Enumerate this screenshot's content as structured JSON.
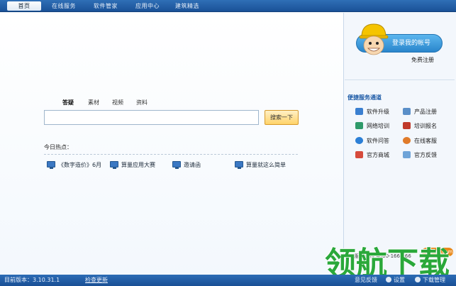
{
  "nav": {
    "tabs": [
      "首页",
      "在线服务",
      "软件管家",
      "应用中心",
      "建筑精选"
    ]
  },
  "search": {
    "tabs": [
      "答疑",
      "素材",
      "视频",
      "资料"
    ],
    "placeholder": "",
    "button": "搜索一下"
  },
  "hot": {
    "title": "今日热点：",
    "items": [
      "《数字造价》6月",
      "算量应用大赛",
      "邀请函",
      "算量就这么简单"
    ]
  },
  "account": {
    "login": "登录我的帐号",
    "register": "免费注册"
  },
  "services": {
    "title": "便捷服务通道",
    "items": [
      "软件升级",
      "产品注册",
      "网络培训",
      "培训报名",
      "软件问答",
      "在线客服",
      "官方商城",
      "官方反馈"
    ]
  },
  "status": {
    "version": "目前版本：3.10.31.1",
    "check_update": "检查更新",
    "feedback": "意见反馈",
    "settings": "设置",
    "download": "下载管理",
    "partial_text": "服务热线 4000-166-166"
  },
  "watermark": {
    "site": "lhdown.com",
    "brand": "领航下载"
  },
  "colors": {
    "nav": "#1a5197",
    "accent": "#2a86cc",
    "watermark": "#2aa83a"
  }
}
